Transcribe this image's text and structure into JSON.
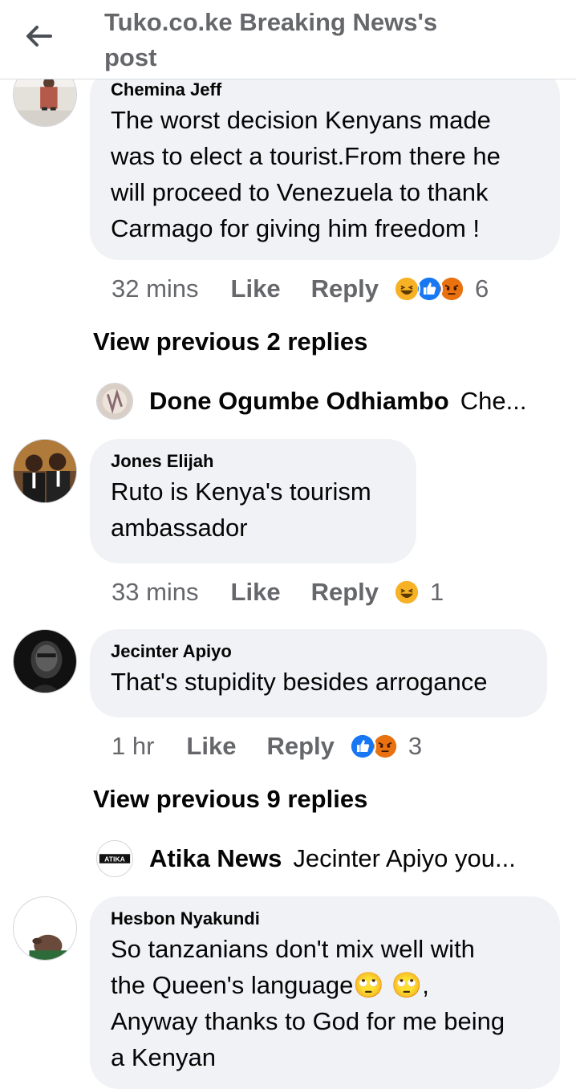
{
  "header": {
    "title_line1": "Tuko.co.ke Breaking News's",
    "title_line2": "post"
  },
  "comments": [
    {
      "author": "Chemina Jeff",
      "lines": [
        "The worst decision Kenyans made",
        "was to elect a tourist.From there he",
        "will proceed to Venezuela to thank",
        "Carmago for giving him freedom !"
      ],
      "time": "32 mins",
      "like": "Like",
      "reply": "Reply",
      "reaction_count": "6",
      "reactions": [
        "haha",
        "like",
        "angry"
      ]
    },
    {
      "author": "Jones Elijah",
      "lines": [
        "Ruto is Kenya's tourism",
        "ambassador"
      ],
      "time": "33 mins",
      "like": "Like",
      "reply": "Reply",
      "reaction_count": "1",
      "reactions": [
        "haha"
      ]
    },
    {
      "author": "Jecinter Apiyo",
      "lines": [
        "That's stupidity besides arrogance"
      ],
      "time": "1 hr",
      "like": "Like",
      "reply": "Reply",
      "reaction_count": "3",
      "reactions": [
        "like",
        "angry"
      ]
    },
    {
      "author": "Hesbon Nyakundi",
      "lines": [
        "So tanzanians don't mix well with",
        "the Queen's language🙄 🙄,",
        "Anyway thanks to God for me being",
        "a Kenyan"
      ]
    }
  ],
  "view_previous": [
    "View previous 2 replies",
    "View previous 9 replies"
  ],
  "reply_previews": [
    {
      "name": "Done Ogumbe Odhiambo",
      "snippet": "Che..."
    },
    {
      "name": "Atika News",
      "snippet": "Jecinter Apiyo you...",
      "logo_text": "ATIKA"
    }
  ],
  "colors": {
    "bubble": "#f0f2f5",
    "meta": "#65676b",
    "like_blue": "#1877f2",
    "angry_red": "#e9710f",
    "haha_yellow": "#f7b125"
  }
}
